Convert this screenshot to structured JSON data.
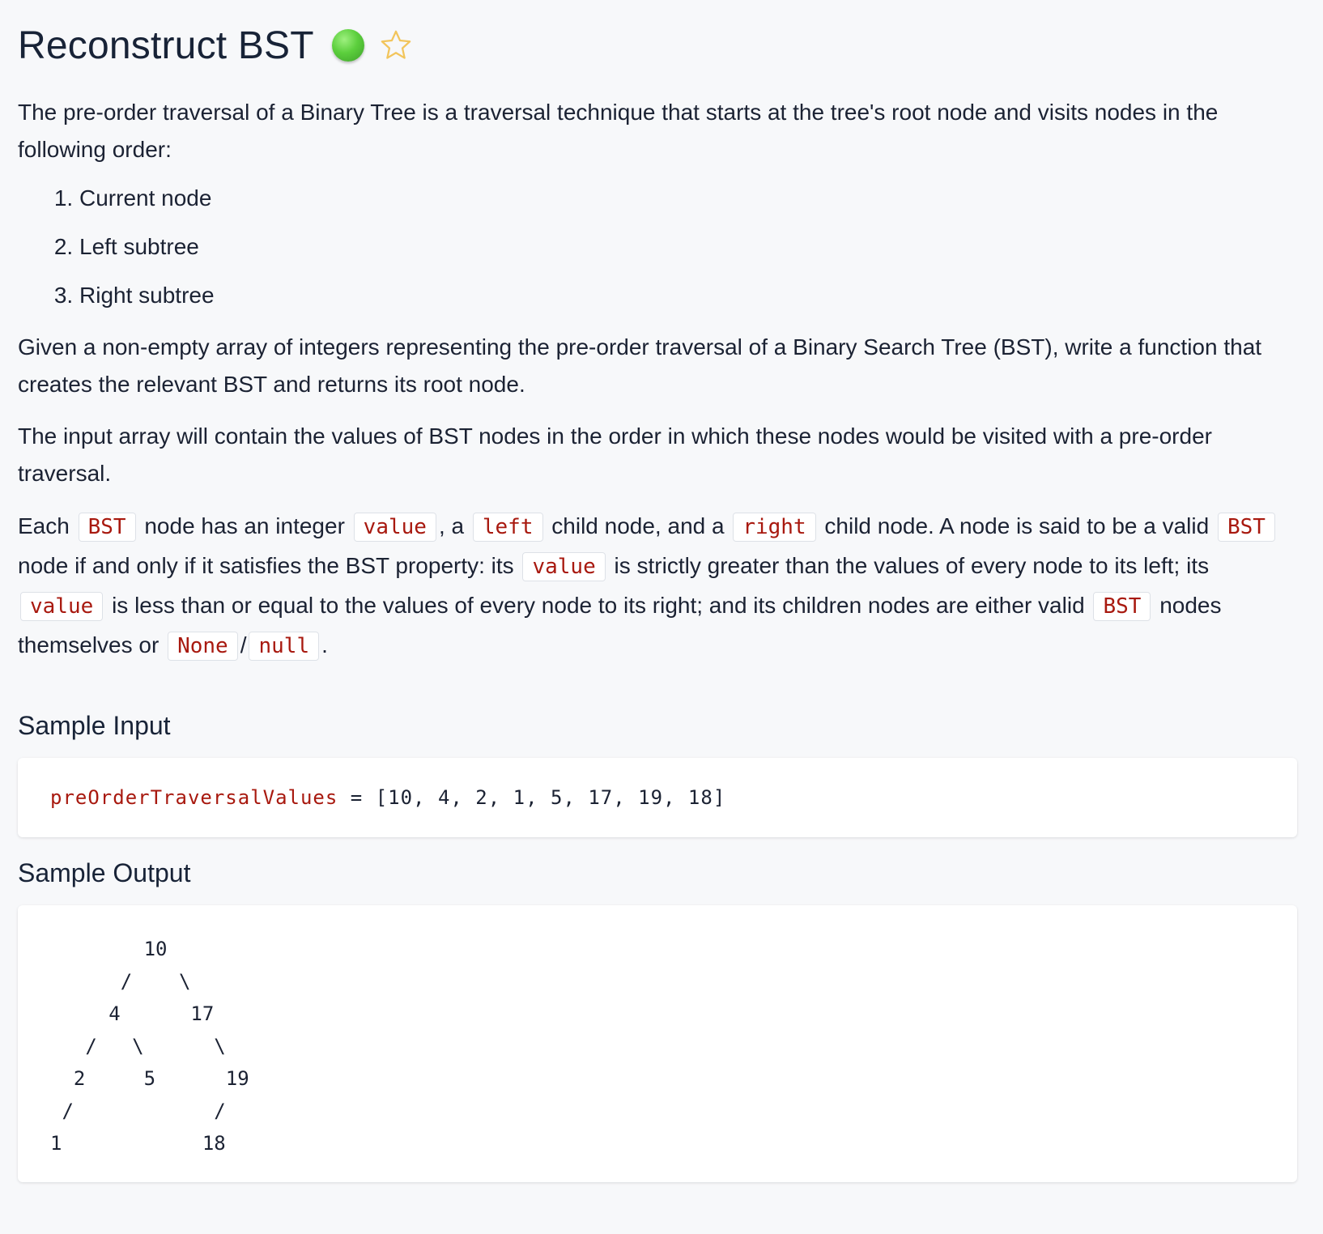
{
  "title": "Reconstruct BST",
  "difficulty_color": "#5ccf3d",
  "star_icon": "star-outline-icon",
  "intro": "The pre-order traversal of a Binary Tree is a traversal technique that starts at the tree's root node and visits nodes in the following order:",
  "order_list": [
    "Current node",
    "Left subtree",
    "Right subtree"
  ],
  "given": "Given a non-empty array of integers representing the pre-order traversal of a Binary Search Tree (BST), write a function that creates the relevant BST and returns its root node.",
  "input_desc": "The input array will contain the values of BST nodes in the order in which these nodes would be visited with a pre-order traversal.",
  "bst_desc": {
    "t1": "Each",
    "c_bst": "BST",
    "t2": "node has an integer",
    "c_value": "value",
    "t3": ", a",
    "c_left": "left",
    "t4": "child node, and a",
    "c_right": "right",
    "t5": "child node. A node is said to be a valid",
    "t6": "node if and only if it satisfies the BST property: its",
    "t7": "is strictly greater than the values of every node to its left; its",
    "t8": "is less than or equal to the values of every node to its right; and its children nodes are either valid",
    "t9": "nodes themselves or",
    "c_none": "None",
    "t10": "/",
    "c_null": "null",
    "t11": "."
  },
  "sample_input_heading": "Sample Input",
  "sample_input": {
    "variable": "preOrderTraversalValues",
    "operator": " = ",
    "value": "[10, 4, 2, 1, 5, 17, 19, 18]"
  },
  "sample_output_heading": "Sample Output",
  "sample_output_lines": [
    "        10",
    "      /    \\",
    "     4      17",
    "   /   \\      \\",
    "  2     5      19",
    " /            /",
    "1            18"
  ]
}
